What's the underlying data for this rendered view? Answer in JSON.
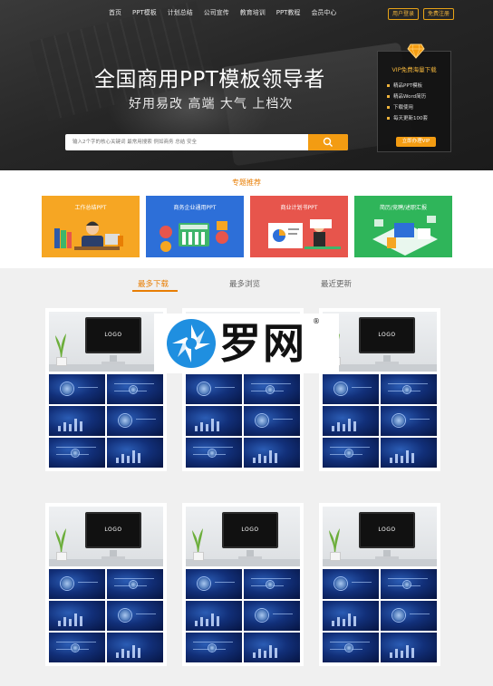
{
  "nav": {
    "links": [
      "首页",
      "PPT模板",
      "计划总结",
      "公司宣传",
      "教育培训",
      "PPT教程",
      "会员中心"
    ],
    "login": "用户登录",
    "register": "免费注册"
  },
  "hero": {
    "title": "全国商用PPT模板领导者",
    "subtitle": "好用易改  高端 大气 上档次",
    "search_placeholder": "输入2个字的核心关键词 最常用搜索 例如商务 总结 安全"
  },
  "vip": {
    "title": "VIP免费海量下载",
    "items": [
      "精品PPT模板",
      "精品Word简历",
      "下载使用",
      "每天更新100套"
    ],
    "button": "立即办理VIP"
  },
  "topics": {
    "title": "专题推荐",
    "items": [
      {
        "label": "工作总结PPT",
        "color": "#f5a623"
      },
      {
        "label": "商务企业通用PPT",
        "color": "#2d6fd8"
      },
      {
        "label": "商业计划书PPT",
        "color": "#e7554c"
      },
      {
        "label": "简历/竞聘/述职汇报",
        "color": "#2fb55a"
      }
    ]
  },
  "tabs": [
    "最多下载",
    "最多浏览",
    "最近更新"
  ],
  "cards": {
    "logo_text": "LOGO",
    "count": 6
  },
  "watermark": {
    "text": "罗网",
    "reg": "®"
  },
  "colors": {
    "accent": "#e87e04",
    "orange": "#f39c12"
  }
}
